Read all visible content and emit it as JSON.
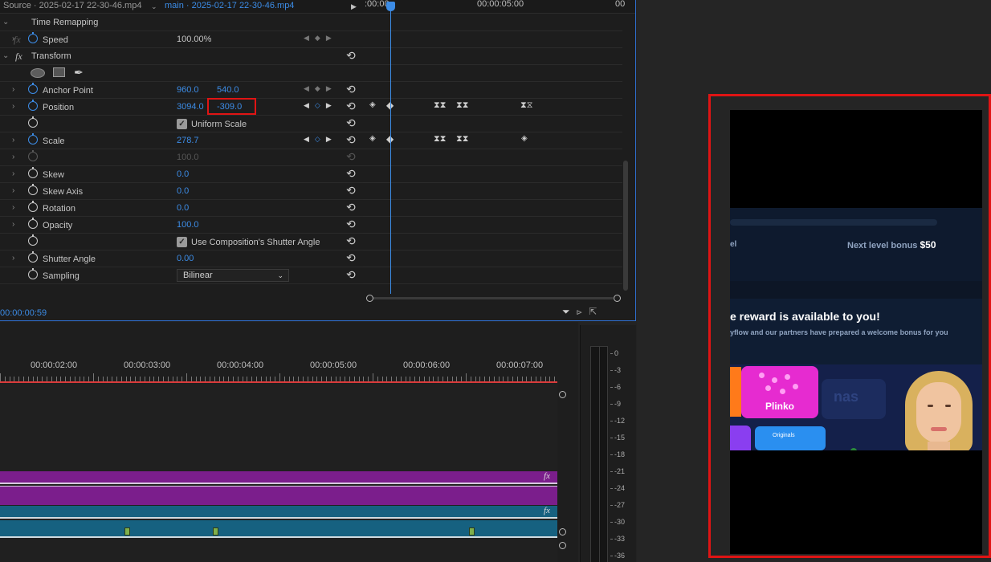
{
  "effect_controls": {
    "source_tab": "Source · 2025-02-17 22-30-46.mp4",
    "sequence_tab": "main · 2025-02-17 22-30-46.mp4",
    "current_time": "00:00:00:59",
    "sections": {
      "time_remapping": "Time Remapping",
      "transform": "Transform",
      "fx_badge": "fx"
    },
    "params": {
      "speed": {
        "label": "Speed",
        "value": "100.00%"
      },
      "anchor_point": {
        "label": "Anchor Point",
        "x": "960.0",
        "y": "540.0"
      },
      "position": {
        "label": "Position",
        "x": "3094.0",
        "y": "-309.0"
      },
      "uniform_scale": {
        "label": "Uniform Scale",
        "checked": true
      },
      "scale": {
        "label": "Scale",
        "value": "278.7"
      },
      "scale_width": {
        "value": "100.0"
      },
      "skew": {
        "label": "Skew",
        "value": "0.0"
      },
      "skew_axis": {
        "label": "Skew Axis",
        "value": "0.0"
      },
      "rotation": {
        "label": "Rotation",
        "value": "0.0"
      },
      "opacity": {
        "label": "Opacity",
        "value": "100.0"
      },
      "composition_shutter": {
        "label": "Use Composition's Shutter Angle",
        "checked": true
      },
      "shutter_angle": {
        "label": "Shutter Angle",
        "value": "0.00"
      },
      "sampling": {
        "label": "Sampling",
        "value": "Bilinear"
      }
    },
    "keyframe_ruler": [
      ":00:00",
      "00:00:05:00",
      "00"
    ],
    "accent_color": "#3c8ce6"
  },
  "timeline": {
    "ruler_labels": [
      "00:00:02:00",
      "00:00:03:00",
      "00:00:04:00",
      "00:00:05:00",
      "00:00:06:00",
      "00:00:07:00"
    ],
    "fx_badge": "fx",
    "clip_colors": {
      "video": "#7b1e8c",
      "audio": "#166180"
    }
  },
  "audio_meter": {
    "levels": [
      "0",
      "-3",
      "-6",
      "-9",
      "-12",
      "-15",
      "-18",
      "-21",
      "-24",
      "-27",
      "-30",
      "-33",
      "-36"
    ]
  },
  "preview": {
    "level_text": "el",
    "next_level_label": "Next level bonus",
    "next_level_value": "$50",
    "headline": "e reward is available to you!",
    "subline": "yflow and our partners have prepared a welcome bonus for you",
    "card_plinko": "Plinko",
    "card_originals": "Originals",
    "card_ghost": "nas",
    "highlight_color": "#e01414"
  }
}
